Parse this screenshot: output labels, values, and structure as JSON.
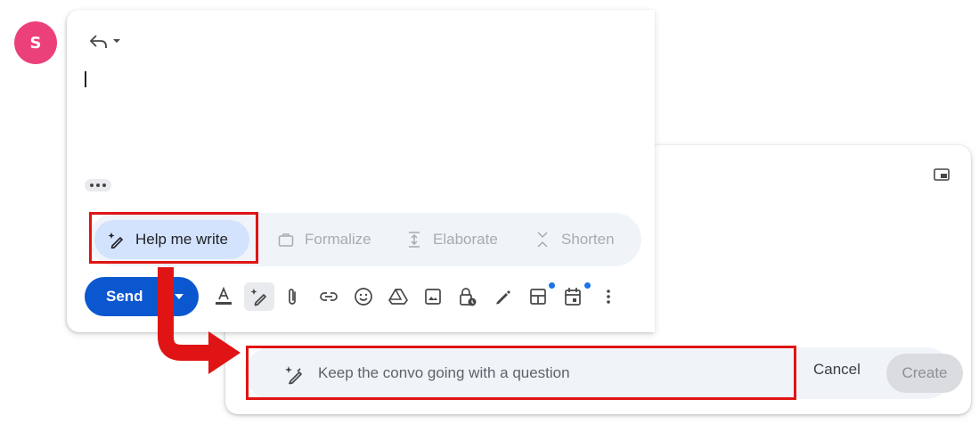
{
  "avatar": {
    "initial": "S",
    "color": "#ec407a"
  },
  "compose": {
    "reply_icon": "reply-icon",
    "more_icon": "chevron-down-icon"
  },
  "suggestions": {
    "help_me_write": "Help me write",
    "formalize": "Formalize",
    "elaborate": "Elaborate",
    "shorten": "Shorten"
  },
  "toolbar": {
    "send_label": "Send",
    "send_color": "#0b57d0",
    "tools": [
      "format-text-icon",
      "help-me-write-icon",
      "attach-icon",
      "link-icon",
      "emoji-icon",
      "drive-icon",
      "photo-icon",
      "confidential-mode-icon",
      "signature-icon",
      "layouts-icon",
      "schedule-event-icon",
      "more-options-icon"
    ]
  },
  "help_me_write_panel": {
    "placeholder": "Keep the convo going with a question",
    "cancel_label": "Cancel",
    "create_label": "Create",
    "minimize_icon": "picture-in-picture-icon"
  },
  "annotation": {
    "color": "#e01414"
  }
}
